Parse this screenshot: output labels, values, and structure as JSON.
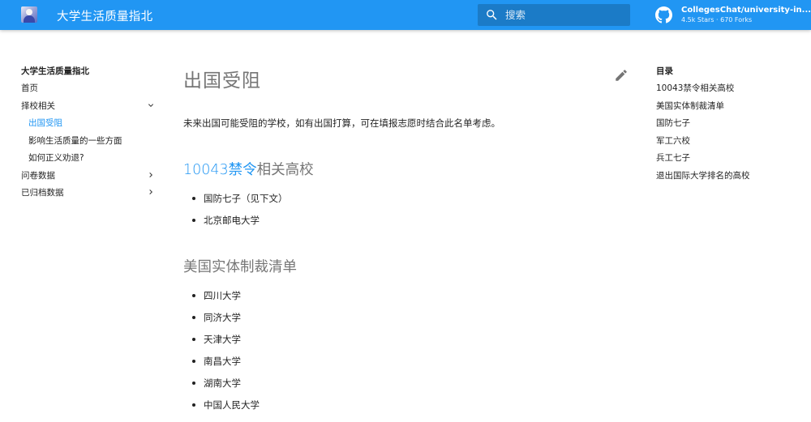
{
  "header": {
    "site_title": "大学生活质量指北",
    "search_placeholder": "搜索",
    "repo_name": "CollegesChat/university-in...",
    "repo_stats": "4.5k Stars · 670 Forks"
  },
  "nav": {
    "title": "大学生活质量指北",
    "items": [
      {
        "label": "首页"
      },
      {
        "label": "择校相关"
      },
      {
        "label": "出国受阻"
      },
      {
        "label": "影响生活质量的一些方面"
      },
      {
        "label": "如何正义劝退?"
      },
      {
        "label": "问卷数据"
      },
      {
        "label": "已归档数据"
      }
    ]
  },
  "main": {
    "title": "出国受阻",
    "intro": "未来出国可能受阻的学校，如有出国打算，可在填报志愿时结合此名单考虑。",
    "sections": [
      {
        "heading_link": "10043禁令",
        "heading_rest": "相关高校",
        "items": [
          "国防七子（见下文）",
          "北京邮电大学"
        ]
      },
      {
        "heading": "美国实体制裁清单",
        "items": [
          "四川大学",
          "同济大学",
          "天津大学",
          "南昌大学",
          "湖南大学",
          "中国人民大学"
        ]
      }
    ]
  },
  "toc": {
    "title": "目录",
    "items": [
      "10043禁令相关高校",
      "美国实体制裁清单",
      "国防七子",
      "军工六校",
      "兵工七子",
      "退出国际大学排名的高校"
    ]
  },
  "colors": {
    "primary": "#2196f3",
    "text": "#212121"
  },
  "icons": [
    "site-logo-icon",
    "search-icon",
    "github-icon",
    "chevron-down-icon",
    "chevron-right-icon",
    "edit-icon"
  ]
}
